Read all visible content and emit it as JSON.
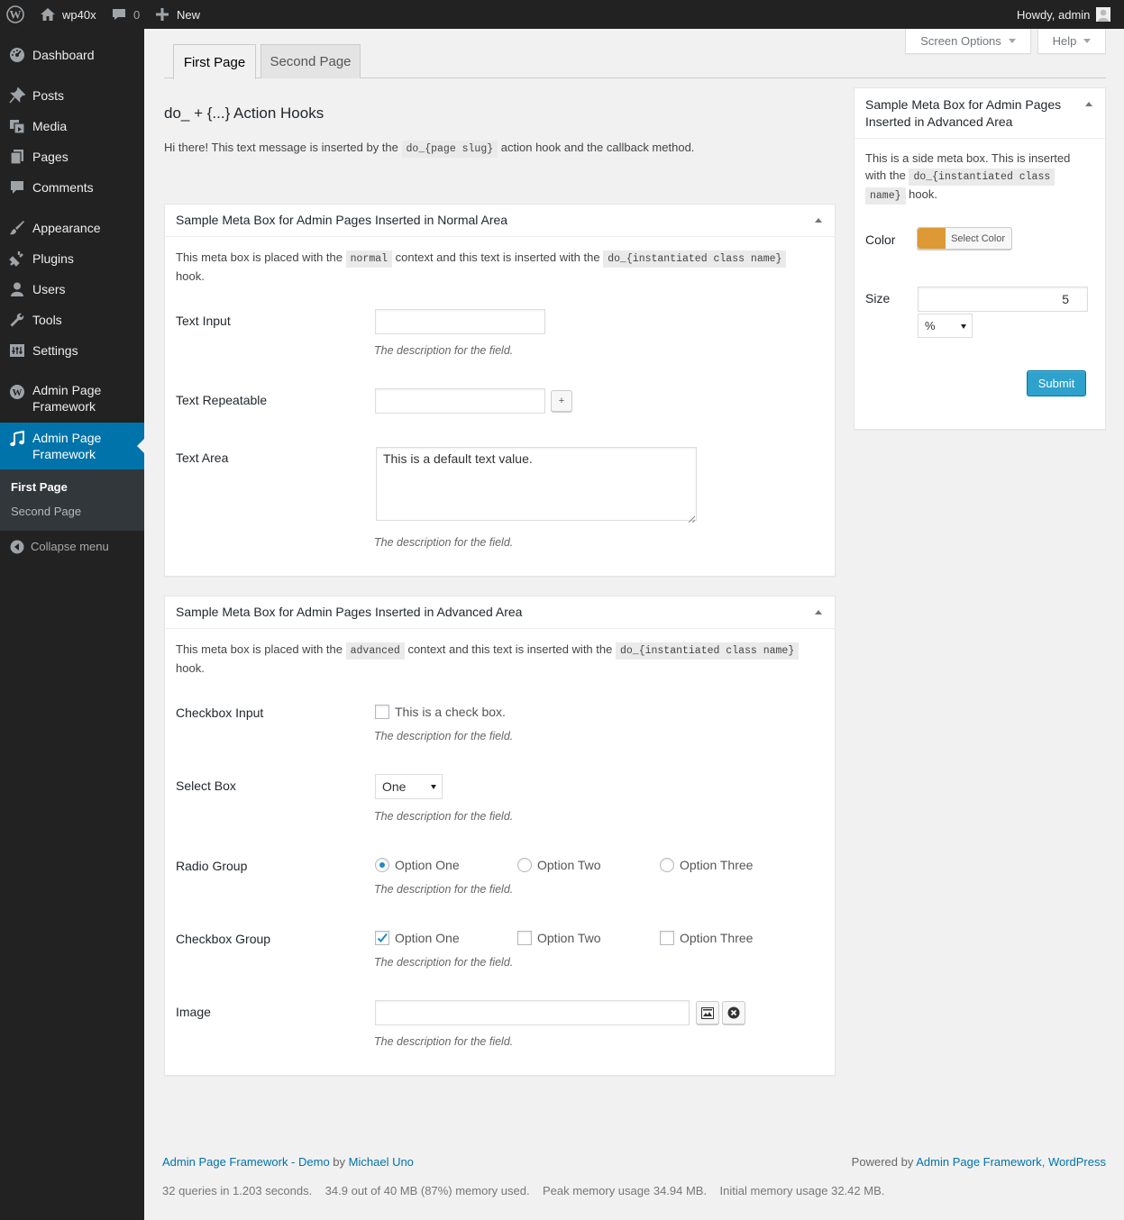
{
  "adminbar": {
    "site_name": "wp40x",
    "comments_count": "0",
    "new_label": "New",
    "howdy": "Howdy, admin"
  },
  "sidebar": {
    "items": [
      {
        "label": "Dashboard",
        "icon": "dashboard-icon"
      },
      {
        "label": "Posts",
        "icon": "pin-icon"
      },
      {
        "label": "Media",
        "icon": "media-icon"
      },
      {
        "label": "Pages",
        "icon": "pages-icon"
      },
      {
        "label": "Comments",
        "icon": "comment-icon"
      },
      {
        "label": "Appearance",
        "icon": "brush-icon"
      },
      {
        "label": "Plugins",
        "icon": "plugin-icon"
      },
      {
        "label": "Users",
        "icon": "user-icon"
      },
      {
        "label": "Tools",
        "icon": "wrench-icon"
      },
      {
        "label": "Settings",
        "icon": "settings-icon"
      },
      {
        "label": "Admin Page Framework",
        "icon": "wordpress-icon"
      },
      {
        "label": "Admin Page Framework",
        "icon": "music-icon"
      }
    ],
    "submenu": [
      "First Page",
      "Second Page"
    ],
    "collapse": "Collapse menu"
  },
  "screen_options": "Screen Options",
  "help": "Help",
  "tabs": [
    "First Page",
    "Second Page"
  ],
  "heading": "do_ + {...} Action Hooks",
  "intro": {
    "before": "Hi there! This text message is inserted by the",
    "code": "do_{page slug}",
    "after": "action hook and the callback method."
  },
  "normal_box": {
    "title": "Sample Meta Box for Admin Pages Inserted in Normal Area",
    "desc_before": "This meta box is placed with the",
    "desc_code1": "normal",
    "desc_mid": "context and this text is inserted with the",
    "desc_code2": "do_{instantiated class name}",
    "desc_after": "hook.",
    "fields": {
      "text_input": {
        "label": "Text Input",
        "value": "",
        "desc": "The description for the field."
      },
      "text_repeatable": {
        "label": "Text Repeatable",
        "value": "",
        "add": "+",
        "desc": ""
      },
      "text_area": {
        "label": "Text Area",
        "value": "This is a default text value.",
        "desc": "The description for the field."
      }
    }
  },
  "advanced_box": {
    "title": "Sample Meta Box for Admin Pages Inserted in Advanced Area",
    "desc_before": "This meta box is placed with the",
    "desc_code1": "advanced",
    "desc_mid": "context and this text is inserted with the",
    "desc_code2": "do_{instantiated class name}",
    "desc_after": "hook.",
    "fields": {
      "checkbox": {
        "label": "Checkbox Input",
        "option": "This is a check box.",
        "checked": false,
        "desc": "The description for the field."
      },
      "select": {
        "label": "Select Box",
        "value": "One",
        "desc": "The description for the field."
      },
      "radio": {
        "label": "Radio Group",
        "options": [
          "Option One",
          "Option Two",
          "Option Three"
        ],
        "selected": "Option One",
        "desc": "The description for the field."
      },
      "checkbox_group": {
        "label": "Checkbox Group",
        "options": [
          "Option One",
          "Option Two",
          "Option Three"
        ],
        "checked": [
          "Option One"
        ],
        "desc": "The description for the field."
      },
      "image": {
        "label": "Image",
        "value": "",
        "desc": "The description for the field."
      }
    }
  },
  "side_box": {
    "title_line1": "Sample Meta Box for Admin Pages",
    "title_line2": "Inserted in Advanced Area",
    "desc_before": "This is a side meta box. This is inserted",
    "desc_with": "with the",
    "desc_code_a": "do_{instantiated class",
    "desc_code_b": "name}",
    "desc_after": "hook.",
    "color_label": "Color",
    "color_value": "#dd9933",
    "select_color": "Select Color",
    "size_label": "Size",
    "size_value": "5",
    "size_unit": "%",
    "submit": "Submit"
  },
  "footer": {
    "left_link1": "Admin Page Framework - Demo",
    "left_by": "by",
    "left_link2": "Michael Uno",
    "right_powered": "Powered by",
    "right_link1": "Admin Page Framework",
    "right_comma": ",",
    "right_link2": "WordPress",
    "stats": "32 queries in 1.203 seconds.    34.9 out of 40 MB (87%) memory used.    Peak memory usage 34.94 MB.    Initial memory usage 32.42 MB."
  },
  "colors": {
    "admin_bar": "#222222",
    "menu_current": "#0073aa",
    "primary_button": "#2ea2cc",
    "link": "#0073aa"
  }
}
